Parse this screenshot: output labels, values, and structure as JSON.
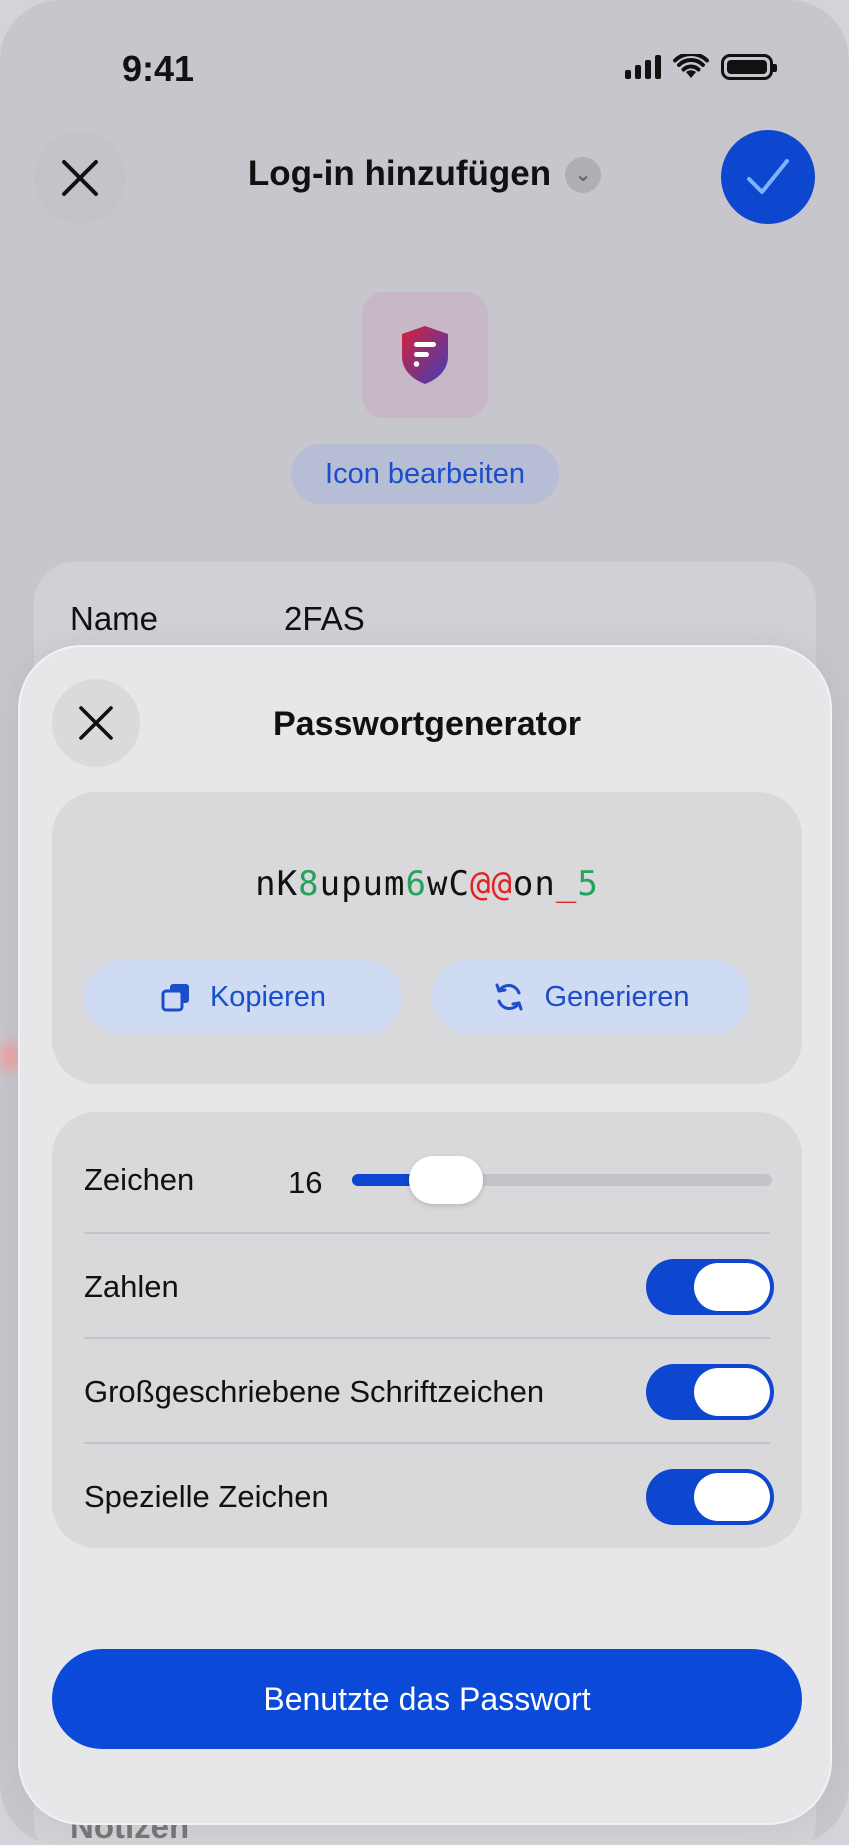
{
  "status_bar": {
    "time": "9:41"
  },
  "background": {
    "title": "Log-in hinzufügen",
    "edit_icon_label": "Icon bearbeiten",
    "name_label": "Name",
    "name_value": "2FAS",
    "notes_label": "Notizen"
  },
  "sheet": {
    "title": "Passwortgenerator",
    "password_parts": [
      {
        "text": "nK",
        "kind": "normal"
      },
      {
        "text": "8",
        "kind": "digit"
      },
      {
        "text": "upum",
        "kind": "normal"
      },
      {
        "text": "6",
        "kind": "digit"
      },
      {
        "text": "wC",
        "kind": "normal"
      },
      {
        "text": "@@",
        "kind": "special"
      },
      {
        "text": "on",
        "kind": "normal"
      },
      {
        "text": "_",
        "kind": "special"
      },
      {
        "text": "5",
        "kind": "digit"
      }
    ],
    "copy_label": "Kopieren",
    "generate_label": "Generieren",
    "characters_label": "Zeichen",
    "characters_value": "16",
    "characters_fraction": 0.2,
    "numbers_label": "Zahlen",
    "numbers_on": true,
    "uppercase_label": "Großgeschriebene Schriftzeichen",
    "uppercase_on": true,
    "special_label": "Spezielle Zeichen",
    "special_on": true,
    "use_label": "Benutzte das Passwort"
  },
  "colors": {
    "accent": "#0d46cf",
    "digit": "#24a35a",
    "special": "#e02424"
  }
}
